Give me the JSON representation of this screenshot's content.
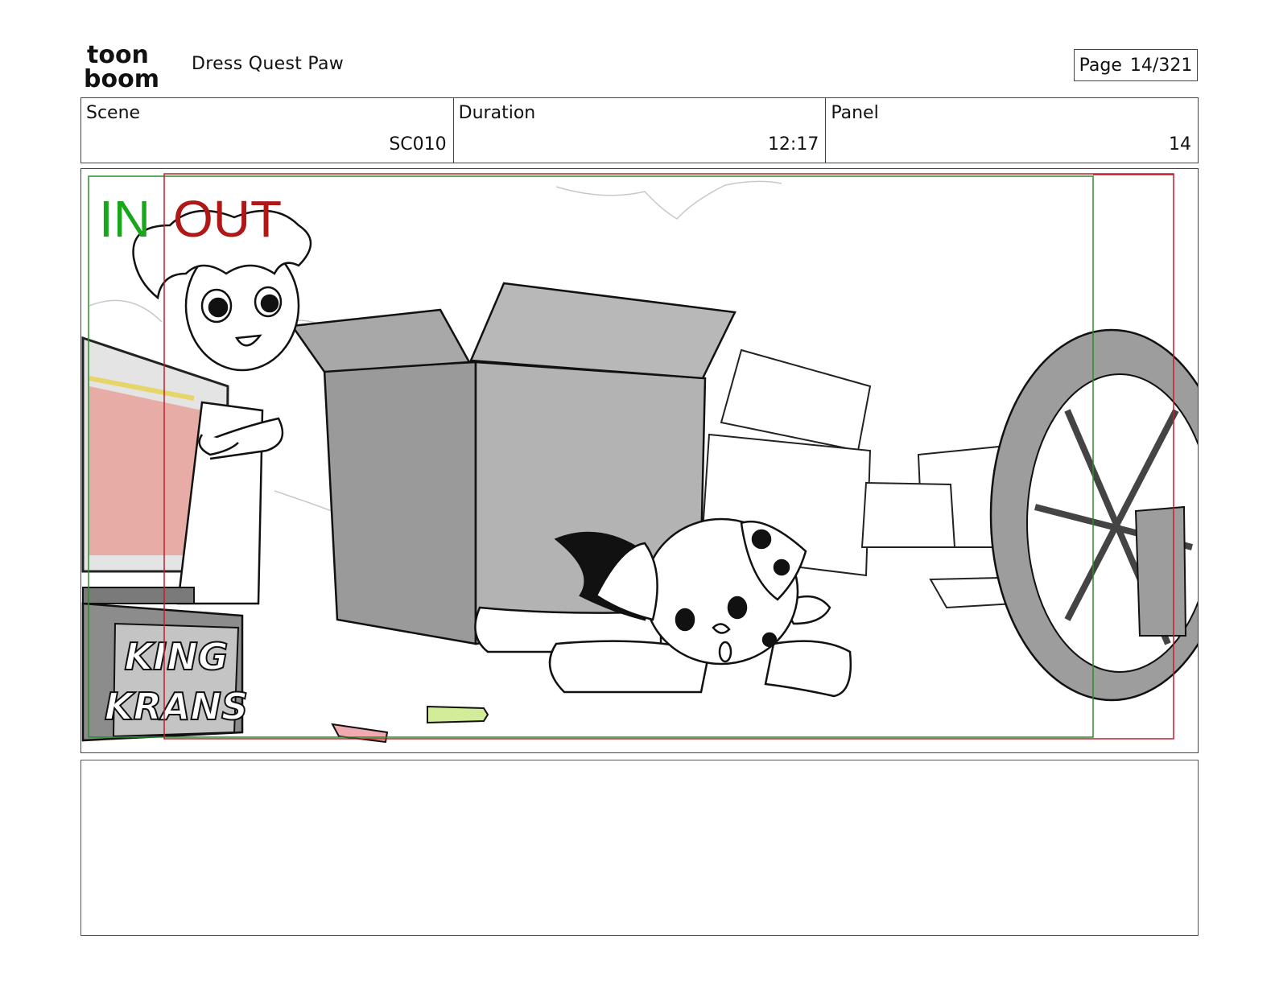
{
  "header": {
    "logo_line1": "toon",
    "logo_line2": "boom",
    "project_title": "Dress Quest Paw",
    "page_label": "Page",
    "page_value": "14/321"
  },
  "info": {
    "scene_label": "Scene",
    "scene_value": "SC010",
    "duration_label": "Duration",
    "duration_value": "12:17",
    "panel_label": "Panel",
    "panel_value": "14"
  },
  "panel_image": {
    "in_label": "IN",
    "out_label": "OUT",
    "box_text_line1": "KING",
    "box_text_line2": "KRANS",
    "in_color": "#1aa61a",
    "out_color": "#b01818"
  },
  "notes": {
    "text": ""
  }
}
